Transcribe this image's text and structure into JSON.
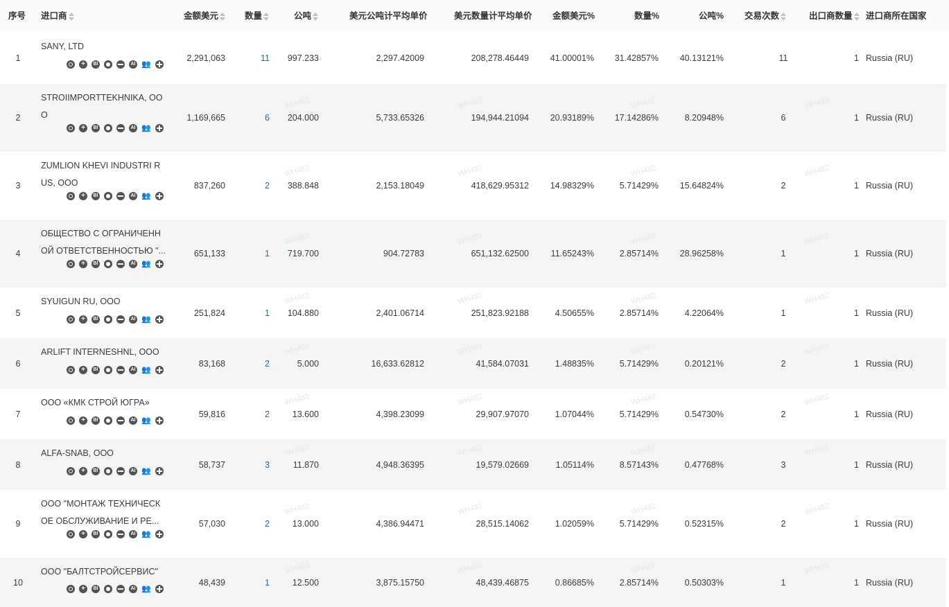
{
  "headers": {
    "index": "序号",
    "importer": "进口商",
    "amount_usd": "金额美元",
    "quantity": "数量",
    "tonnes": "公吨",
    "usd_per_tonne": "美元公吨计平均单价",
    "usd_per_qty": "美元数量计平均单价",
    "amount_pct": "金额美元%",
    "qty_pct": "数量%",
    "tonne_pct": "公吨%",
    "trades": "交易次数",
    "exporters": "出口商数量",
    "country": "进口商所在国家"
  },
  "icon_ai_label": "AI",
  "icon_bi_label": "BI",
  "watermark": "WH482",
  "rows": [
    {
      "index": "1",
      "name": "SANY, LTD",
      "amount": "2,291,063",
      "qty": "11",
      "tonnes": "997.233",
      "usd_t": "2,297.42009",
      "usd_q": "208,278.46449",
      "amount_pct": "41.00001%",
      "qty_pct": "31.42857%",
      "t_pct": "40.13121%",
      "trades": "11",
      "exporters": "1",
      "country": "Russia (RU)"
    },
    {
      "index": "2",
      "name": "STROIIMPORTTEKHNIKA, OOO",
      "amount": "1,169,665",
      "qty": "6",
      "tonnes": "204.000",
      "usd_t": "5,733.65326",
      "usd_q": "194,944.21094",
      "amount_pct": "20.93189%",
      "qty_pct": "17.14286%",
      "t_pct": "8.20948%",
      "trades": "6",
      "exporters": "1",
      "country": "Russia (RU)"
    },
    {
      "index": "3",
      "name": "ZUMLION KHEVI INDUSTRI RUS, OOO",
      "amount": "837,260",
      "qty": "2",
      "tonnes": "388.848",
      "usd_t": "2,153.18049",
      "usd_q": "418,629.95312",
      "amount_pct": "14.98329%",
      "qty_pct": "5.71429%",
      "t_pct": "15.64824%",
      "trades": "2",
      "exporters": "1",
      "country": "Russia (RU)"
    },
    {
      "index": "4",
      "name": "ОБЩЕСТВО С ОГРАНИЧЕННОЙ ОТВЕТСТВЕННОСТЬЮ \"...",
      "amount": "651,133",
      "qty": "1",
      "tonnes": "719.700",
      "usd_t": "904.72783",
      "usd_q": "651,132.62500",
      "amount_pct": "11.65243%",
      "qty_pct": "2.85714%",
      "t_pct": "28.96258%",
      "trades": "1",
      "exporters": "1",
      "country": "Russia (RU)"
    },
    {
      "index": "5",
      "name": "SYUIGUN RU, OOO",
      "amount": "251,824",
      "qty": "1",
      "tonnes": "104.880",
      "usd_t": "2,401.06714",
      "usd_q": "251,823.92188",
      "amount_pct": "4.50655%",
      "qty_pct": "2.85714%",
      "t_pct": "4.22064%",
      "trades": "1",
      "exporters": "1",
      "country": "Russia (RU)"
    },
    {
      "index": "6",
      "name": "ARLIFT INTERNESHNL, OOO",
      "amount": "83,168",
      "qty": "2",
      "tonnes": "5.000",
      "usd_t": "16,633.62812",
      "usd_q": "41,584.07031",
      "amount_pct": "1.48835%",
      "qty_pct": "5.71429%",
      "t_pct": "0.20121%",
      "trades": "2",
      "exporters": "1",
      "country": "Russia (RU)"
    },
    {
      "index": "7",
      "name": "ООО «КМК СТРОЙ ЮГРА»",
      "amount": "59,816",
      "qty": "2",
      "tonnes": "13.600",
      "usd_t": "4,398.23099",
      "usd_q": "29,907.97070",
      "amount_pct": "1.07044%",
      "qty_pct": "5.71429%",
      "t_pct": "0.54730%",
      "trades": "2",
      "exporters": "1",
      "country": "Russia (RU)"
    },
    {
      "index": "8",
      "name": "ALFA-SNAB, OOO",
      "amount": "58,737",
      "qty": "3",
      "tonnes": "11.870",
      "usd_t": "4,948.36395",
      "usd_q": "19,579.02669",
      "amount_pct": "1.05114%",
      "qty_pct": "8.57143%",
      "t_pct": "0.47768%",
      "trades": "3",
      "exporters": "1",
      "country": "Russia (RU)"
    },
    {
      "index": "9",
      "name": "ООО \"МОНТАЖ ТЕХНИЧЕСКОЕ ОБСЛУЖИВАНИЕ И РЕ...",
      "amount": "57,030",
      "qty": "2",
      "tonnes": "13.000",
      "usd_t": "4,386.94471",
      "usd_q": "28,515.14062",
      "amount_pct": "1.02059%",
      "qty_pct": "5.71429%",
      "t_pct": "0.52315%",
      "trades": "2",
      "exporters": "1",
      "country": "Russia (RU)"
    },
    {
      "index": "10",
      "name": "ООО \"БАЛТСТРОЙСЕРВИС\"",
      "amount": "48,439",
      "qty": "1",
      "tonnes": "12.500",
      "usd_t": "3,875.15750",
      "usd_q": "48,439.46875",
      "amount_pct": "0.86685%",
      "qty_pct": "2.85714%",
      "t_pct": "0.50303%",
      "trades": "1",
      "exporters": "1",
      "country": "Russia (RU)"
    }
  ],
  "colors": {
    "link": "#1a6ea3",
    "row_alt": "#f5f5f5",
    "icon": "#525252",
    "sort_arrow": "#c7bcc6"
  }
}
